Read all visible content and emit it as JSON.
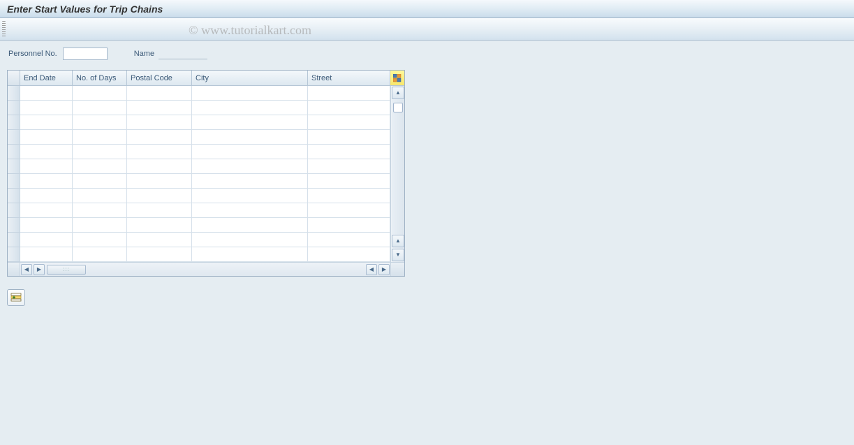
{
  "title": "Enter Start Values for Trip Chains",
  "watermark": "© www.tutorialkart.com",
  "form": {
    "personnel_label": "Personnel No.",
    "personnel_value": "",
    "name_label": "Name",
    "name_value": ""
  },
  "table": {
    "columns": [
      {
        "key": "end_date",
        "label": "End Date"
      },
      {
        "key": "days",
        "label": "No. of Days"
      },
      {
        "key": "postal",
        "label": "Postal Code"
      },
      {
        "key": "city",
        "label": "City"
      },
      {
        "key": "street",
        "label": "Street"
      }
    ],
    "rows": [
      {
        "end_date": "",
        "days": "",
        "postal": "",
        "city": "",
        "street": ""
      },
      {
        "end_date": "",
        "days": "",
        "postal": "",
        "city": "",
        "street": ""
      },
      {
        "end_date": "",
        "days": "",
        "postal": "",
        "city": "",
        "street": ""
      },
      {
        "end_date": "",
        "days": "",
        "postal": "",
        "city": "",
        "street": ""
      },
      {
        "end_date": "",
        "days": "",
        "postal": "",
        "city": "",
        "street": ""
      },
      {
        "end_date": "",
        "days": "",
        "postal": "",
        "city": "",
        "street": ""
      },
      {
        "end_date": "",
        "days": "",
        "postal": "",
        "city": "",
        "street": ""
      },
      {
        "end_date": "",
        "days": "",
        "postal": "",
        "city": "",
        "street": ""
      },
      {
        "end_date": "",
        "days": "",
        "postal": "",
        "city": "",
        "street": ""
      },
      {
        "end_date": "",
        "days": "",
        "postal": "",
        "city": "",
        "street": ""
      },
      {
        "end_date": "",
        "days": "",
        "postal": "",
        "city": "",
        "street": ""
      },
      {
        "end_date": "",
        "days": "",
        "postal": "",
        "city": "",
        "street": ""
      }
    ]
  }
}
